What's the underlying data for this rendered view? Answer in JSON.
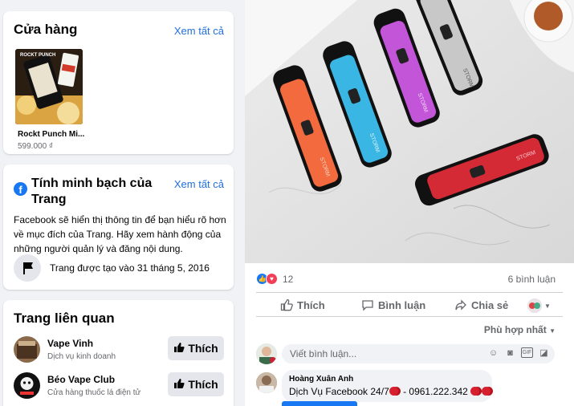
{
  "shop": {
    "title": "Cửa hàng",
    "see_all": "Xem tất cả",
    "product": {
      "name": "Rockt Punch Mi...",
      "price": "599.000 ₫",
      "image_label": "ROCKT PUNCH"
    }
  },
  "transparency": {
    "title": "Tính minh bạch của Trang",
    "see_all": "Xem tất cả",
    "description": "Facebook sẽ hiển thị thông tin để bạn hiểu rõ hơn về mục đích của Trang. Hãy xem hành động của những người quản lý và đăng nội dung.",
    "created": "Trang được tạo vào 31 tháng 5, 2016",
    "icon": "facebook-icon"
  },
  "related": {
    "title": "Trang liên quan",
    "pages": [
      {
        "name": "Vape Vinh",
        "category": "Dịch vụ kinh doanh",
        "button": "Thích"
      },
      {
        "name": "Béo Vape Club",
        "category": "Cửa hàng thuốc lá điện tử",
        "button": "Thích"
      }
    ]
  },
  "post": {
    "photo_text": [
      "STORM",
      "STORM",
      "STORM",
      "STORM",
      "STORM"
    ],
    "reaction_count": "12",
    "comment_count": "6 bình luận",
    "actions": {
      "like": "Thích",
      "comment": "Bình luận",
      "share": "Chia sẻ"
    },
    "sort_label": "Phù hợp nhất",
    "comment_placeholder": "Viết bình luận...",
    "first_comment": {
      "author": "Hoàng Xuân Anh",
      "text_before": "Dịch Vụ Facebook 24/7",
      "text_after": " - 0961.222.342 "
    }
  },
  "colors": {
    "accent": "#1877f2",
    "link": "#216fdb",
    "love": "#f33e58"
  }
}
